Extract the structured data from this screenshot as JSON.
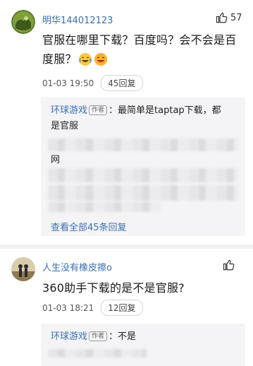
{
  "comments": [
    {
      "username": "明华144012123",
      "like_count": "57",
      "text_line1": "官服在哪里下载？百度吗？会不会是百",
      "text_line2": "度服？",
      "timestamp": "01-03 19:50",
      "reply_label": "45回复",
      "replies": {
        "first_user": "环球游戏",
        "author_tag": "作者",
        "first_text_line1": "：最简单是taptap下载，都",
        "first_text_line2": "是官服",
        "partial_char": "网",
        "view_all": "查看全部45条回复"
      }
    },
    {
      "username": "人生没有橡皮擦o",
      "like_count": "",
      "text_line1": "360助手下载的是不是官服?",
      "timestamp": "01-03 18:21",
      "reply_label": "12回复",
      "replies": {
        "first_user": "环球游戏",
        "author_tag": "作者",
        "first_text": "：不是"
      }
    }
  ]
}
